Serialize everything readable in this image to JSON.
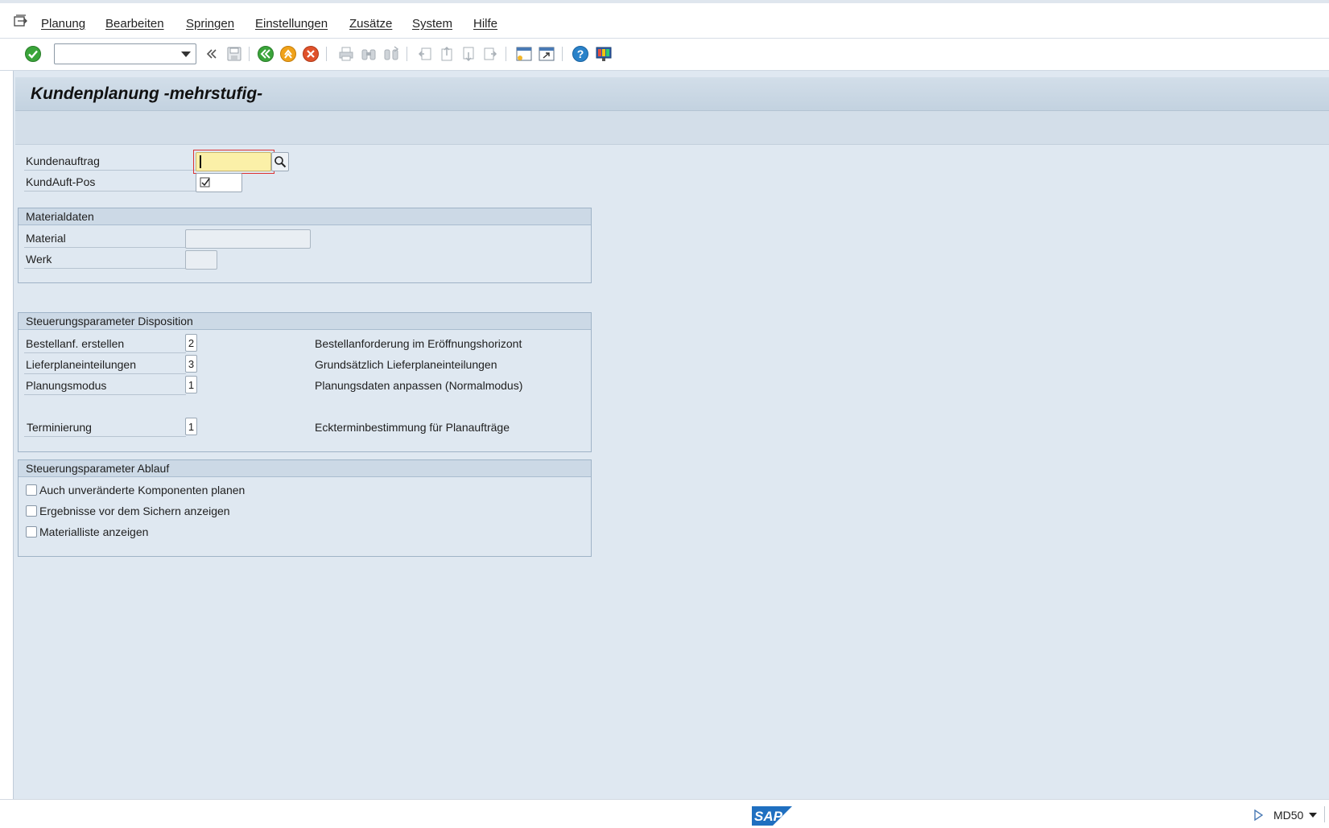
{
  "menu": {
    "items": [
      "Planung",
      "Bearbeiten",
      "Springen",
      "Einstellungen",
      "Zusätze",
      "System",
      "Hilfe"
    ]
  },
  "toolbar": {
    "command_field_value": "",
    "icons": [
      "enter-icon",
      "back-icon",
      "save-icon",
      "green-back-icon",
      "exit-icon",
      "cancel-icon",
      "print-icon",
      "find-icon",
      "find-next-icon",
      "first-page-icon",
      "previous-page-icon",
      "next-page-icon",
      "last-page-icon",
      "new-session-icon",
      "shortcut-icon",
      "help-icon",
      "customize-layout-icon"
    ]
  },
  "page": {
    "title": "Kundenplanung -mehrstufig-"
  },
  "order": {
    "kundenauftrag_label": "Kundenauftrag",
    "kundenauftrag_value": "",
    "kundauftpos_label": "KundAuft-Pos",
    "kundauftpos_value": ""
  },
  "materialdaten": {
    "title": "Materialdaten",
    "material_label": "Material",
    "material_value": "",
    "werk_label": "Werk",
    "werk_value": ""
  },
  "disposition": {
    "title": "Steuerungsparameter Disposition",
    "rows": [
      {
        "label": "Bestellanf. erstellen",
        "value": "2",
        "description": "Bestellanforderung im Eröffnungshorizont"
      },
      {
        "label": "Lieferplaneinteilungen",
        "value": "3",
        "description": "Grundsätzlich Lieferplaneinteilungen"
      },
      {
        "label": "Planungsmodus",
        "value": "1",
        "description": "Planungsdaten anpassen (Normalmodus)"
      },
      {
        "label": "Terminierung",
        "value": "1",
        "description": "Eckterminbestimmung für Planaufträge"
      }
    ]
  },
  "ablauf": {
    "title": "Steuerungsparameter Ablauf",
    "options": [
      {
        "label": "Auch unveränderte  Komponenten planen",
        "checked": false
      },
      {
        "label": "Ergebnisse vor dem Sichern anzeigen",
        "checked": false
      },
      {
        "label": "Materialliste anzeigen",
        "checked": false
      }
    ]
  },
  "statusbar": {
    "logo_text": "SAP",
    "transaction": "MD50"
  },
  "colors": {
    "background": "#dfe8f1",
    "header": "#ccd9e6",
    "focus_field": "#fbf0a8",
    "sap_blue": "#1f6fc0"
  }
}
